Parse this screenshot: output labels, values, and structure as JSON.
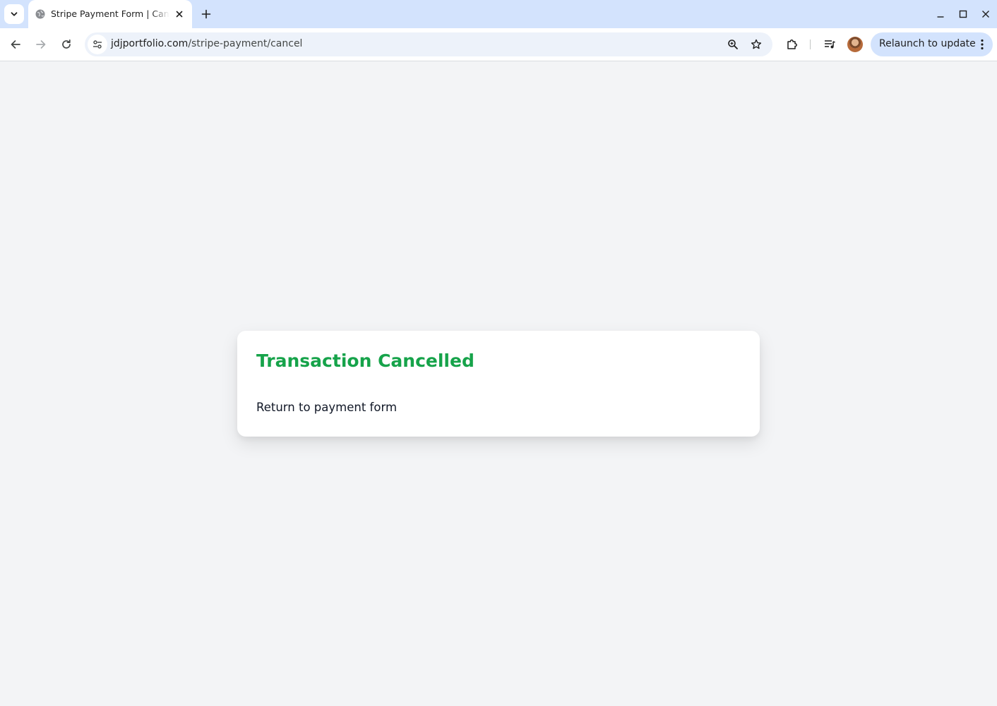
{
  "browser": {
    "tab": {
      "title": "Stripe Payment Form | Cancel"
    },
    "address_bar": {
      "host": "jdjportfolio.com",
      "path": "/stripe-payment/cancel"
    },
    "relaunch_label": "Relaunch to update",
    "icons": {
      "tab_search": "chevron-down-icon",
      "favicon": "globe-icon",
      "tab_close": "close-icon",
      "new_tab": "plus-icon",
      "minimize": "minimize-icon",
      "maximize": "maximize-icon",
      "close_window": "close-icon",
      "back": "arrow-left-icon",
      "forward": "arrow-right-icon",
      "reload": "reload-icon",
      "site_info": "tune-icon",
      "zoom": "zoom-icon",
      "bookmark": "star-icon",
      "extensions": "puzzle-icon",
      "media": "media-control-icon",
      "profile": "avatar",
      "menu": "kebab-icon"
    },
    "colors": {
      "tabstrip_bg": "#d3e3fd",
      "omnibox_bg": "#edf2fa",
      "relaunch_bg": "#d3e3fd"
    }
  },
  "page": {
    "background": "#f3f4f6",
    "card": {
      "title": "Transaction Cancelled",
      "link_text": "Return to payment form",
      "title_color": "#16a34a"
    }
  }
}
